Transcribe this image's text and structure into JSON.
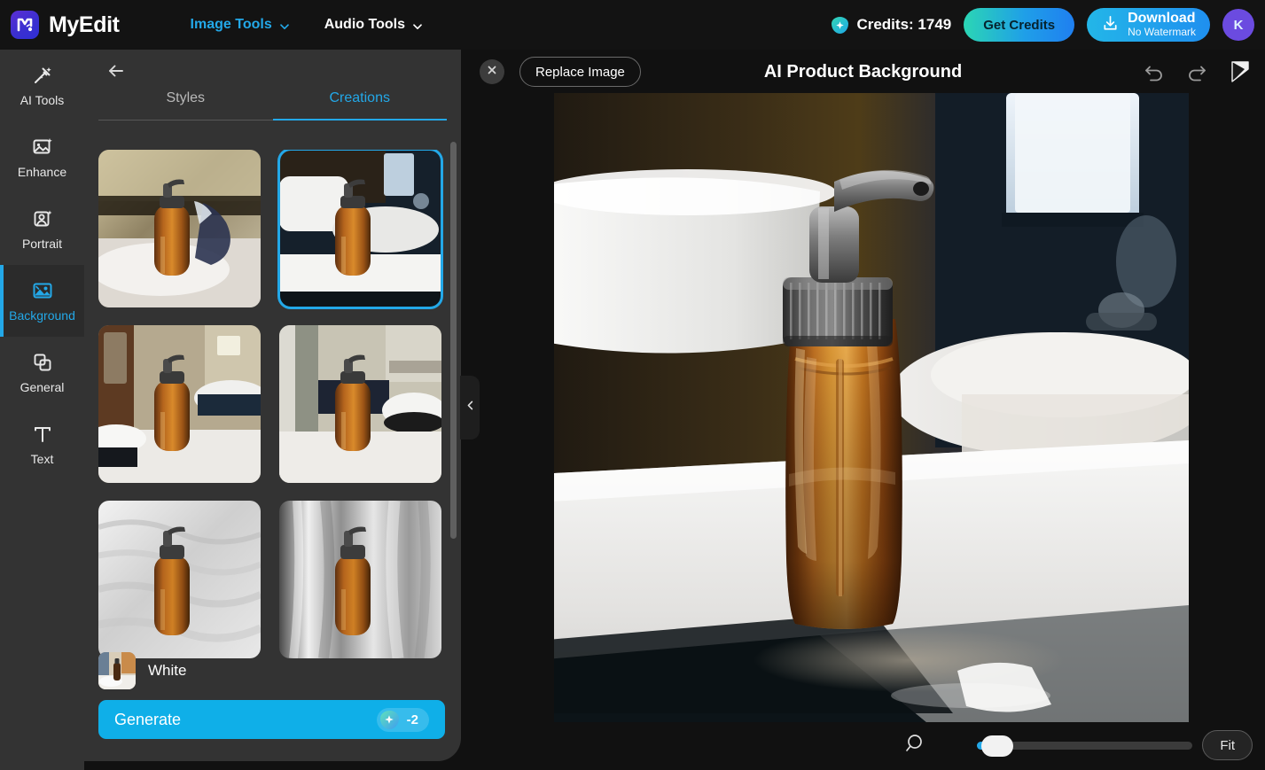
{
  "topbar": {
    "brand": "MyEdit",
    "brand_logo_icon": "myedit-logo-icon",
    "nav": [
      {
        "label": "Image Tools",
        "icon": "chevron-down-icon",
        "accent": true
      },
      {
        "label": "Audio Tools",
        "icon": "chevron-down-icon",
        "accent": false
      }
    ],
    "credits_label": "Credits: 1749",
    "credits_icon": "gem-icon",
    "get_credits_label": "Get Credits",
    "download_title": "Download",
    "download_sub": "No Watermark",
    "download_icon": "download-icon",
    "avatar_initial": "K"
  },
  "rail": {
    "items": [
      {
        "label": "AI Tools",
        "icon": "magic-wand-icon",
        "active": false
      },
      {
        "label": "Enhance",
        "icon": "image-sparkle-icon",
        "active": false
      },
      {
        "label": "Portrait",
        "icon": "portrait-sparkle-icon",
        "active": false
      },
      {
        "label": "Background",
        "icon": "background-image-icon",
        "active": true
      },
      {
        "label": "General",
        "icon": "layers-icon",
        "active": false
      },
      {
        "label": "Text",
        "icon": "text-t-icon",
        "active": false
      }
    ]
  },
  "panel": {
    "back_icon": "arrow-left-icon",
    "tabs": [
      {
        "label": "Styles",
        "active": false
      },
      {
        "label": "Creations",
        "active": true
      }
    ],
    "creations": [
      {
        "alt": "amber soap dispenser on white plate with towels",
        "selected": false
      },
      {
        "alt": "amber soap dispenser beside white basin, window light",
        "selected": true
      },
      {
        "alt": "amber soap dispenser with mirror and sink behind",
        "selected": false
      },
      {
        "alt": "amber soap dispenser with white bowl on counter",
        "selected": false
      },
      {
        "alt": "amber soap dispenser on crumpled white fabric",
        "selected": false
      },
      {
        "alt": "amber soap dispenser on white silk drape",
        "selected": false
      }
    ],
    "preset_name": "White",
    "preset_thumb_alt": "white bathroom preset thumbnail",
    "generate_label": "Generate",
    "generate_cost": "-2",
    "generate_cost_icon": "gem-icon",
    "collapse_icon": "chevron-left-icon"
  },
  "canvas": {
    "close_icon": "close-x-icon",
    "replace_label": "Replace Image",
    "title": "AI Product Background",
    "tools": [
      {
        "icon": "undo-icon"
      },
      {
        "icon": "redo-icon"
      },
      {
        "icon": "cursor-select-icon"
      }
    ],
    "image_alt": "Amber glass soap dispenser with metal pump on white bathroom counter",
    "zoom": {
      "magnifier_icon": "magnifier-icon",
      "slider_value": 2,
      "fit_label": "Fit"
    }
  },
  "colors": {
    "accent": "#23a8e8",
    "generate": "#0fafe8",
    "panel_bg": "#333333",
    "topbar_bg": "#131313",
    "canvas_bg": "#111111",
    "avatar": "#6b4be0"
  }
}
